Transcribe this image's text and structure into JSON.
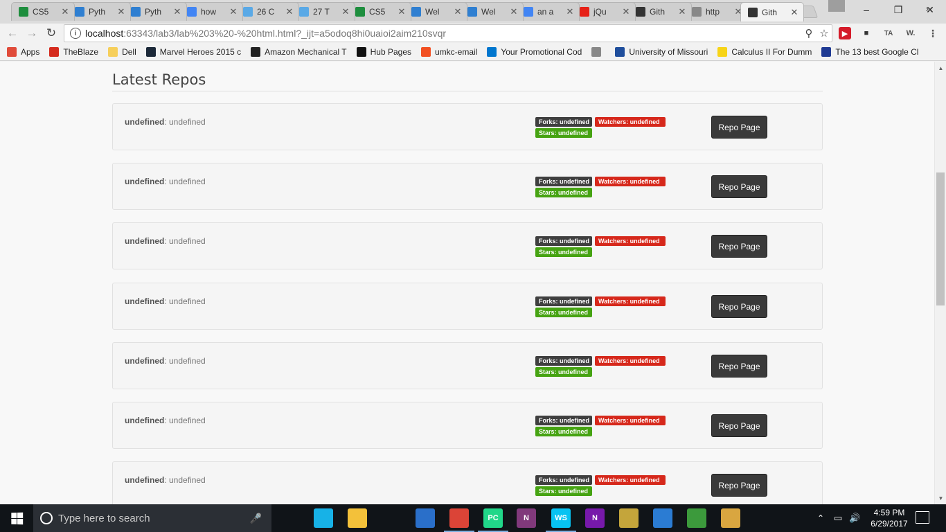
{
  "browser": {
    "tabs": [
      {
        "title": "CS5",
        "icon": "sheets-icon",
        "color": "#1e8e3e"
      },
      {
        "title": "Pyth",
        "icon": "box-icon",
        "color": "#2f7fd1"
      },
      {
        "title": "Pyth",
        "icon": "box-icon",
        "color": "#2f7fd1"
      },
      {
        "title": "how",
        "icon": "google-icon",
        "color": "#4285f4"
      },
      {
        "title": "26 C",
        "icon": "chart-icon",
        "color": "#5aa9e6"
      },
      {
        "title": "27 T",
        "icon": "chart-icon",
        "color": "#5aa9e6"
      },
      {
        "title": "CS5",
        "icon": "sheets-icon",
        "color": "#1e8e3e"
      },
      {
        "title": "Wel",
        "icon": "box-icon",
        "color": "#2f7fd1"
      },
      {
        "title": "Wel",
        "icon": "box-icon",
        "color": "#2f7fd1"
      },
      {
        "title": "an a",
        "icon": "google-icon",
        "color": "#4285f4"
      },
      {
        "title": "jQu",
        "icon": "youtube-icon",
        "color": "#e62117"
      },
      {
        "title": "Gith",
        "icon": "webstorm-icon",
        "color": "#333333"
      },
      {
        "title": "http",
        "icon": "page-icon",
        "color": "#888888"
      },
      {
        "title": "Gith",
        "icon": "webstorm-icon",
        "color": "#333333"
      }
    ],
    "active_tab_index": 13,
    "url_host": "localhost",
    "url_rest": ":63343/lab3/lab%203%20-%20html.html?_ijt=a5odoq8hi0uaioi2aim210svqr"
  },
  "bookmarks": [
    {
      "label": "Apps",
      "icon": "apps-grid-icon",
      "color": "#e04b3a"
    },
    {
      "label": "TheBlaze",
      "icon": "theblaze-icon",
      "color": "#d52b1e"
    },
    {
      "label": "Dell",
      "icon": "folder-icon",
      "color": "#f6cf5b"
    },
    {
      "label": "Marvel Heroes 2015 c",
      "icon": "steam-icon",
      "color": "#1b2838"
    },
    {
      "label": "Amazon Mechanical T",
      "icon": "amazon-icon",
      "color": "#222222"
    },
    {
      "label": "Hub Pages",
      "icon": "hubpages-icon",
      "color": "#111111"
    },
    {
      "label": "umkc-email",
      "icon": "microsoft-icon",
      "color": "#f25022"
    },
    {
      "label": "Your Promotional Cod",
      "icon": "dell-icon",
      "color": "#0076ce"
    },
    {
      "label": "",
      "icon": "page-icon",
      "color": "#888888"
    },
    {
      "label": "University of Missouri",
      "icon": "umkc-icon",
      "color": "#1f4e9c"
    },
    {
      "label": "Calculus II For Dumm",
      "icon": "dummies-icon",
      "color": "#f7d417"
    },
    {
      "label": "The 13 best Google Cl",
      "icon": "businessinsider-icon",
      "color": "#1f3a93"
    }
  ],
  "page": {
    "heading": "Latest Repos",
    "repos": [
      {
        "name": "undefined",
        "desc": "undefined",
        "forks": "Forks: undefined",
        "watchers": "Watchers: undefined",
        "stars": "Stars: undefined",
        "button": "Repo Page"
      },
      {
        "name": "undefined",
        "desc": "undefined",
        "forks": "Forks: undefined",
        "watchers": "Watchers: undefined",
        "stars": "Stars: undefined",
        "button": "Repo Page"
      },
      {
        "name": "undefined",
        "desc": "undefined",
        "forks": "Forks: undefined",
        "watchers": "Watchers: undefined",
        "stars": "Stars: undefined",
        "button": "Repo Page"
      },
      {
        "name": "undefined",
        "desc": "undefined",
        "forks": "Forks: undefined",
        "watchers": "Watchers: undefined",
        "stars": "Stars: undefined",
        "button": "Repo Page"
      },
      {
        "name": "undefined",
        "desc": "undefined",
        "forks": "Forks: undefined",
        "watchers": "Watchers: undefined",
        "stars": "Stars: undefined",
        "button": "Repo Page"
      },
      {
        "name": "undefined",
        "desc": "undefined",
        "forks": "Forks: undefined",
        "watchers": "Watchers: undefined",
        "stars": "Stars: undefined",
        "button": "Repo Page"
      },
      {
        "name": "undefined",
        "desc": "undefined",
        "forks": "Forks: undefined",
        "watchers": "Watchers: undefined",
        "stars": "Stars: undefined",
        "button": "Repo Page"
      }
    ],
    "badge_colors": {
      "forks": "#3f3f3f",
      "watchers": "#d6281b",
      "stars": "#46a312"
    }
  },
  "taskbar": {
    "search_placeholder": "Type here to search",
    "apps": [
      {
        "icon": "task-view-icon",
        "color": "#101418",
        "label": ""
      },
      {
        "icon": "kodi-icon",
        "color": "#17b2e7",
        "label": ""
      },
      {
        "icon": "file-explorer-icon",
        "color": "#f3c13a",
        "label": ""
      },
      {
        "icon": "store-icon",
        "color": "#101418",
        "label": ""
      },
      {
        "icon": "thunderbird-icon",
        "color": "#2a6fc9",
        "label": ""
      },
      {
        "icon": "chrome-icon",
        "color": "#db4437",
        "label": ""
      },
      {
        "icon": "pycharm-icon",
        "color": "#21d789",
        "label": "PC"
      },
      {
        "icon": "onenote-icon",
        "color": "#80397b",
        "label": "N"
      },
      {
        "icon": "webstorm-icon",
        "color": "#07c3f2",
        "label": "WS"
      },
      {
        "icon": "onenote2-icon",
        "color": "#7719aa",
        "label": "N"
      },
      {
        "icon": "winrar-icon",
        "color": "#c4a53b",
        "label": ""
      },
      {
        "icon": "app-icon",
        "color": "#2b7cd3",
        "label": ""
      },
      {
        "icon": "notepad-icon",
        "color": "#3c9a3c",
        "label": ""
      },
      {
        "icon": "paint-icon",
        "color": "#d9a640",
        "label": ""
      }
    ],
    "time": "4:59 PM",
    "date": "6/29/2017"
  }
}
